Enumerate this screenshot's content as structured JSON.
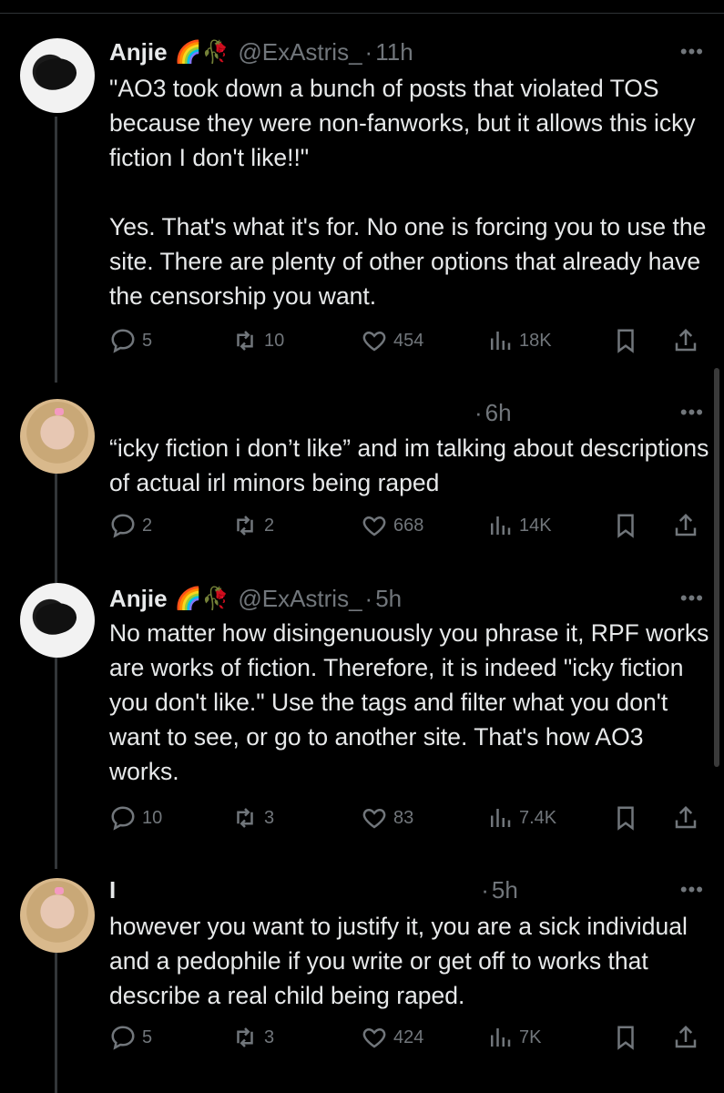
{
  "tweets": [
    {
      "name": "Anjie",
      "badges": "🌈🥀",
      "handle": "@ExAstris_",
      "dot": "·",
      "time": "11h",
      "text": "\"AO3 took down a bunch of posts that violated TOS because they were non-fanworks, but it allows this icky fiction I don't like!!\"\n\nYes. That's what it's for. No one is forcing you to use the site. There are plenty of other options that already have the censorship you want.",
      "replies": "5",
      "retweets": "10",
      "likes": "454",
      "views": "18K"
    },
    {
      "name": "",
      "badges": "",
      "handle": "",
      "dot": "·",
      "time": "6h",
      "text": "“icky fiction i don’t like” and im talking about descriptions of actual irl minors being raped",
      "replies": "2",
      "retweets": "2",
      "likes": "668",
      "views": "14K"
    },
    {
      "name": "Anjie",
      "badges": "🌈🥀",
      "handle": "@ExAstris_",
      "dot": "·",
      "time": "5h",
      "text": "No matter how disingenuously you phrase it, RPF works are works of fiction. Therefore, it is indeed \"icky fiction you don't like.\" Use the tags and filter what you don't want to see, or go to another site. That's how AO3 works.",
      "replies": "10",
      "retweets": "3",
      "likes": "83",
      "views": "7.4K"
    },
    {
      "name": "I",
      "badges": "",
      "handle": "",
      "dot": "·",
      "time": "5h",
      "text": "however you want to justify it, you are a sick individual and a pedophile if you write or get off to works that describe a real child being raped.",
      "replies": "5",
      "retweets": "3",
      "likes": "424",
      "views": "7K"
    }
  ],
  "more_label": "•••",
  "icons": [
    "reply-icon",
    "retweet-icon",
    "like-icon",
    "views-icon",
    "bookmark-icon",
    "share-icon"
  ],
  "colors": {
    "background": "#000000",
    "text": "#e7e9ea",
    "muted": "#71767b"
  }
}
